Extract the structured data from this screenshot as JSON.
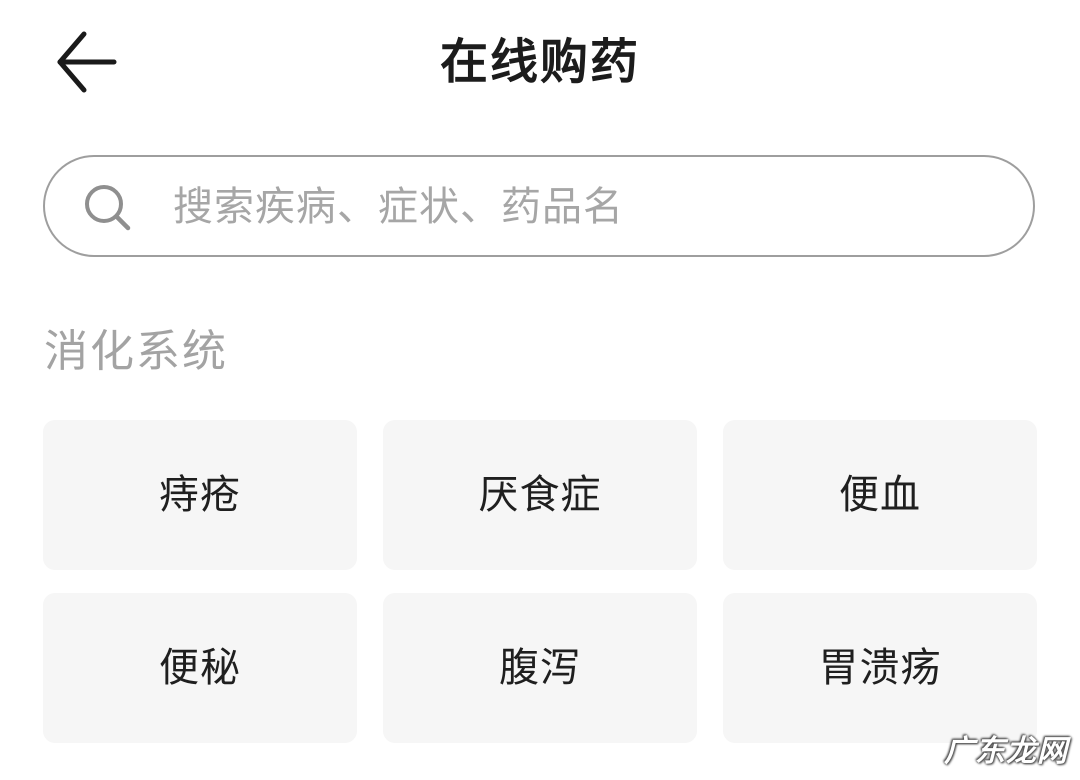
{
  "header": {
    "back_icon": "arrow-left-icon",
    "title": "在线购药"
  },
  "search": {
    "icon": "search-icon",
    "placeholder": "搜索疾病、症状、药品名"
  },
  "section": {
    "title": "消化系统",
    "items": [
      {
        "label": "痔疮"
      },
      {
        "label": "厌食症"
      },
      {
        "label": "便血"
      },
      {
        "label": "便秘"
      },
      {
        "label": "腹泻"
      },
      {
        "label": "胃溃疡"
      }
    ]
  },
  "watermark": {
    "text": "广东龙网"
  },
  "colors": {
    "background": "#ffffff",
    "title_text": "#1c1c1c",
    "placeholder_text": "#a6a6a6",
    "section_title_text": "#a3a3a3",
    "tile_background": "#f6f6f6",
    "search_border": "#9e9e9e"
  }
}
